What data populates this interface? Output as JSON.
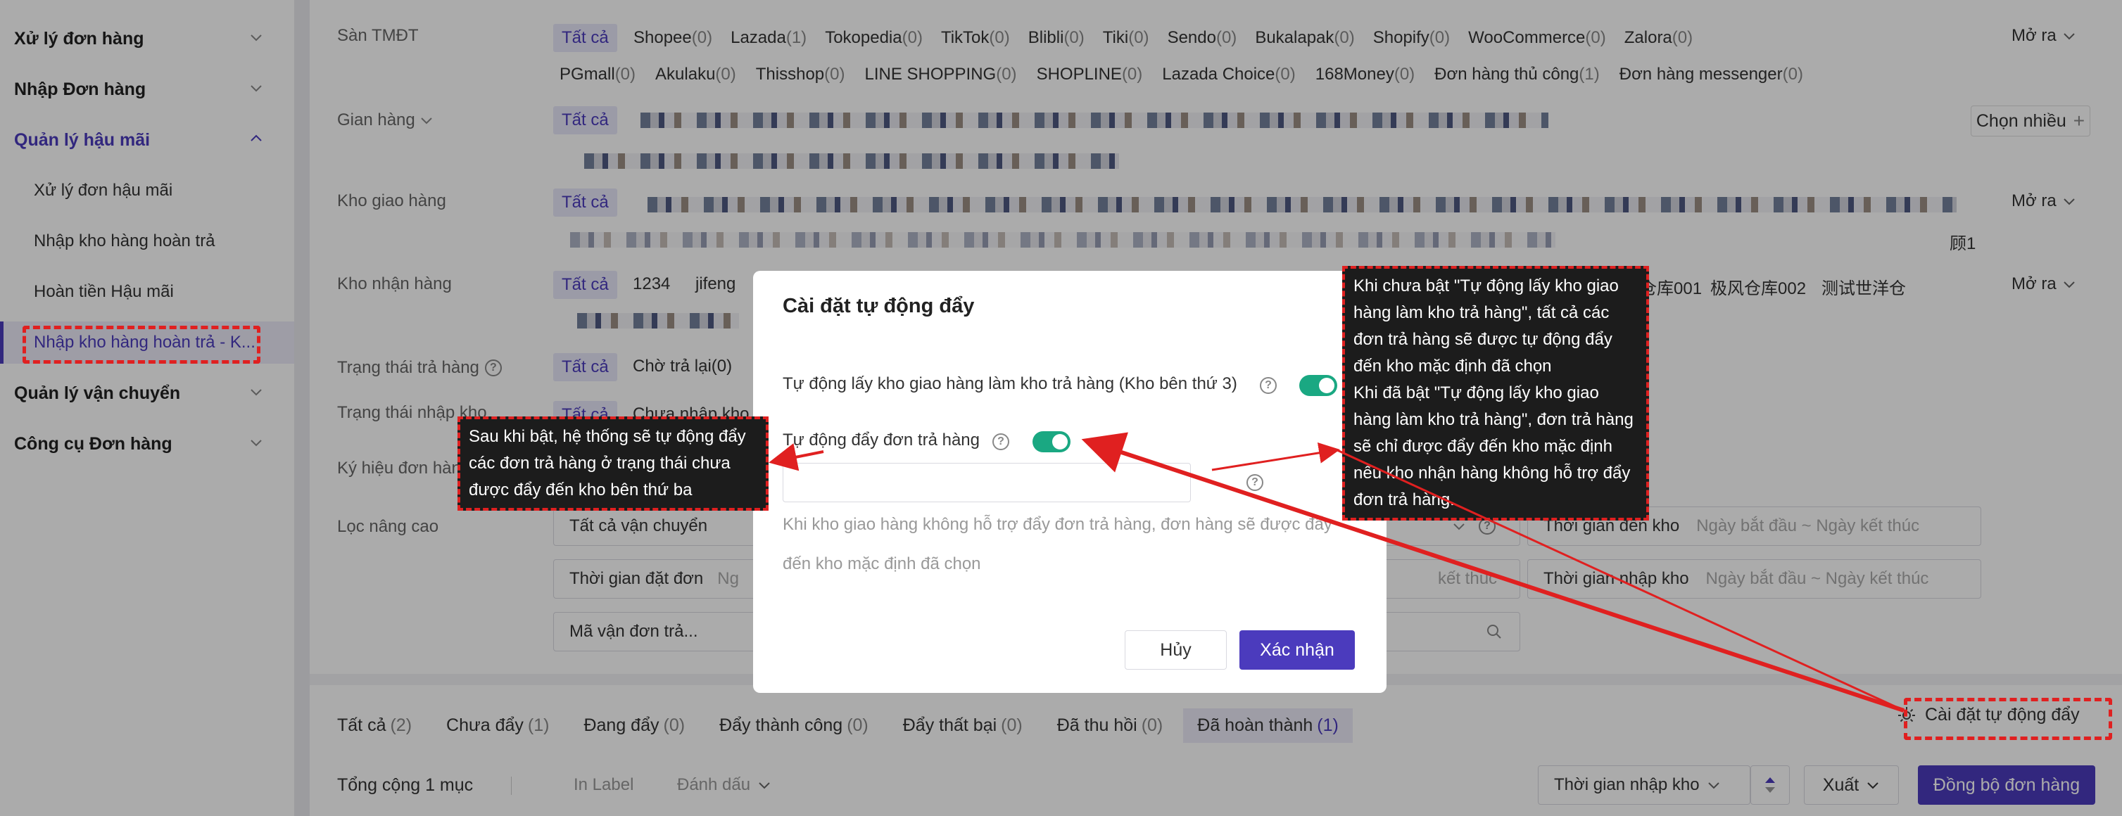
{
  "sidebar": {
    "groups": [
      {
        "label": "Xử lý đơn hàng"
      },
      {
        "label": "Nhập Đơn hàng"
      },
      {
        "label": "Quản lý hậu mãi"
      },
      {
        "label": "Quản lý vận chuyển"
      },
      {
        "label": "Công cụ Đơn hàng"
      }
    ],
    "items": [
      {
        "label": "Xử lý đơn hậu mãi"
      },
      {
        "label": "Nhập kho hàng hoàn trả"
      },
      {
        "label": "Hoàn tiền Hậu mãi"
      },
      {
        "label": "Nhập kho hàng hoàn trả - K..."
      }
    ]
  },
  "filters": {
    "platform_label": "Sàn TMĐT",
    "all": "Tất cả",
    "expand": "Mở ra",
    "platforms_row1": [
      {
        "name": "Shopee",
        "count": "(0)"
      },
      {
        "name": "Lazada",
        "count": "(1)"
      },
      {
        "name": "Tokopedia",
        "count": "(0)"
      },
      {
        "name": "TikTok",
        "count": "(0)"
      },
      {
        "name": "Blibli",
        "count": "(0)"
      },
      {
        "name": "Tiki",
        "count": "(0)"
      },
      {
        "name": "Sendo",
        "count": "(0)"
      },
      {
        "name": "Bukalapak",
        "count": "(0)"
      },
      {
        "name": "Shopify",
        "count": "(0)"
      },
      {
        "name": "WooCommerce",
        "count": "(0)"
      },
      {
        "name": "Zalora",
        "count": "(0)"
      }
    ],
    "platforms_row2": [
      {
        "name": "PGmall",
        "count": "(0)"
      },
      {
        "name": "Akulaku",
        "count": "(0)"
      },
      {
        "name": "Thisshop",
        "count": "(0)"
      },
      {
        "name": "LINE SHOPPING",
        "count": "(0)"
      },
      {
        "name": "SHOPLINE",
        "count": "(0)"
      },
      {
        "name": "Lazada Choice",
        "count": "(0)"
      },
      {
        "name": "168Money",
        "count": "(0)"
      },
      {
        "name": "Đơn hàng thủ công",
        "count": "(1)"
      },
      {
        "name": "Đơn hàng messenger",
        "count": "(0)"
      }
    ],
    "store_label": "Gian hàng",
    "choose_many": "Chọn nhiều",
    "ship_wh_label": "Kho giao hàng",
    "ship_wh_trailing": "顾1",
    "recv_wh_label": "Kho nhận hàng",
    "recv_wh_options": [
      "1234",
      "jifeng"
    ],
    "recv_wh_options_right": [
      "仓库001",
      "极风仓库002",
      "测试世洋仓"
    ],
    "return_status_label": "Trạng thái trả hàng",
    "return_status_option": "Chờ trả lại(0)",
    "import_status_label": "Trạng thái nhập kho",
    "import_status_option": "Chưa nhập kho",
    "symbol_label": "Ký hiệu đơn hàng",
    "advanced_label": "Lọc nâng cao",
    "carrier_select": "Tất cả vận chuyển",
    "order_time": "Thời gian đặt đơn",
    "order_time_short": "Ng",
    "tracking_select": "Mã vận đơn trả...",
    "arrive_time": "Thời gian đến kho",
    "import_time": "Thời gian nhập kho",
    "date_placeholder": "Ngày bắt đầu ~ Ngày kết thúc",
    "date_end": "kết thúc"
  },
  "tabs": [
    {
      "label": "Tất cả",
      "count": "(2)"
    },
    {
      "label": "Chưa đẩy",
      "count": "(1)"
    },
    {
      "label": "Đang đẩy",
      "count": "(0)"
    },
    {
      "label": "Đẩy thành công",
      "count": "(0)"
    },
    {
      "label": "Đẩy thất bại",
      "count": "(0)"
    },
    {
      "label": "Đã thu hồi",
      "count": "(0)"
    },
    {
      "label": "Đã hoàn thành",
      "count": "(1)"
    }
  ],
  "auto_push_settings": "Cài đặt tự động đẩy",
  "footer": {
    "total": "Tổng cộng 1 mục",
    "in_label": "In Label",
    "mark": "Đánh dấu",
    "sort_select": "Thời gian nhập kho",
    "export": "Xuất",
    "sync": "Đồng bộ đơn hàng"
  },
  "modal": {
    "title": "Cài đặt tự động đẩy",
    "row1_label": "Tự động lấy kho giao hàng làm kho trả hàng (Kho bên thứ 3)",
    "row1_on": true,
    "row2_label": "Tự động đẩy đơn trả hàng",
    "row2_on": true,
    "note_line1": "Khi kho giao hàng không hỗ trợ đẩy đơn trả hàng, đơn hàng sẽ được đẩy",
    "note_line2": "đến kho mặc định đã chọn",
    "cancel": "Hủy",
    "confirm": "Xác nhận"
  },
  "tooltips": {
    "left_lines": [
      "Sau khi bật, hệ thống sẽ tự động đẩy",
      "các đơn trả hàng ở trạng thái chưa",
      "được đẩy đến kho bên thứ ba"
    ],
    "right_lines": [
      "Khi chưa bật \"Tự động lấy kho giao",
      "hàng làm kho trả hàng\", tất cả các",
      "đơn trả hàng sẽ được tự động đẩy",
      "đến kho mặc định đã chọn",
      "Khi đã bật \"Tự động lấy kho giao",
      "hàng làm kho trả hàng\", đơn trả hàng",
      "sẽ chỉ được đẩy đến kho mặc định",
      "nếu kho nhận hàng không hỗ trợ đẩy",
      "đơn trả hàng."
    ]
  },
  "colors": {
    "accent": "#4b3bbd",
    "toggle_on": "#1aa882",
    "annotation": "#e02020"
  }
}
